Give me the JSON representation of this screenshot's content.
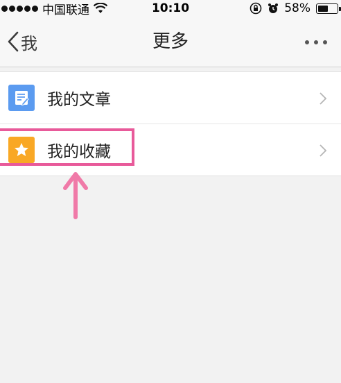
{
  "status_bar": {
    "carrier": "中国联通",
    "time": "10:10",
    "battery": "58%",
    "battery_level": 0.58,
    "icons": [
      "signal-dots-icon",
      "wifi-icon",
      "rotation-lock-icon",
      "alarm-icon",
      "battery-icon"
    ]
  },
  "nav": {
    "back_label": "我",
    "title": "更多",
    "more_icon": "more-dots-icon"
  },
  "list": {
    "items": [
      {
        "label": "我的文章",
        "icon": "article-icon",
        "icon_color": "#5b9bf0"
      },
      {
        "label": "我的收藏",
        "icon": "star-icon",
        "icon_color": "#f9a825"
      }
    ]
  },
  "annotation": {
    "highlight_color": "#e85a9a",
    "arrow_color": "#f07aa8"
  }
}
